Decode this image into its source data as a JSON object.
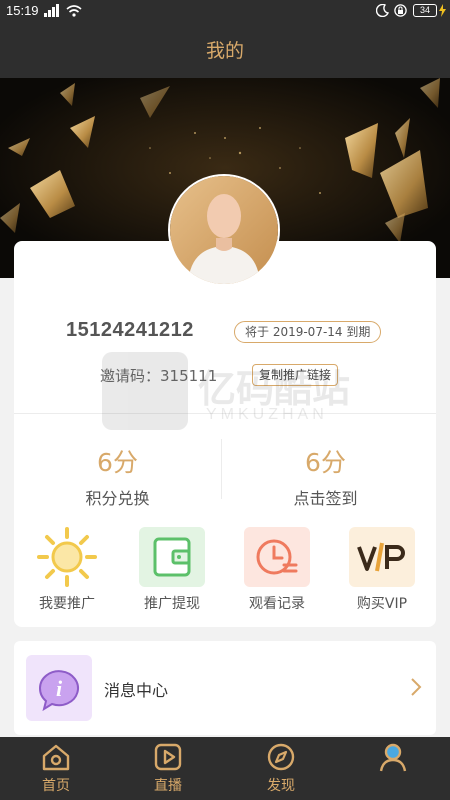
{
  "status_bar": {
    "time": "15:19",
    "battery": "34"
  },
  "header": {
    "title": "我的"
  },
  "profile": {
    "phone": "15124241212",
    "expiry": "将于 2019-07-14 到期",
    "invite_code": "邀请码：315111",
    "copy_link_label": "复制推广链接"
  },
  "stats": [
    {
      "value": "6分",
      "label": "积分兑换"
    },
    {
      "value": "6分",
      "label": "点击签到"
    }
  ],
  "features": [
    {
      "label": "我要推广",
      "icon": "sun-icon"
    },
    {
      "label": "推广提现",
      "icon": "wallet-icon"
    },
    {
      "label": "观看记录",
      "icon": "clock-list-icon"
    },
    {
      "label": "购买VIP",
      "icon": "vip-icon"
    }
  ],
  "menu": {
    "message_center": "消息中心"
  },
  "watermark": {
    "cn": "亿码酷站",
    "en": "YMKUZHAN"
  },
  "nav": [
    {
      "label": "首页",
      "icon": "home-icon"
    },
    {
      "label": "直播",
      "icon": "play-icon"
    },
    {
      "label": "发现",
      "icon": "compass-icon"
    },
    {
      "label": "",
      "icon": "user-icon"
    }
  ],
  "colors": {
    "accent_gold": "#d8a96a",
    "header_bg": "#2e2e2e",
    "page_bg": "#f2f2f2"
  }
}
